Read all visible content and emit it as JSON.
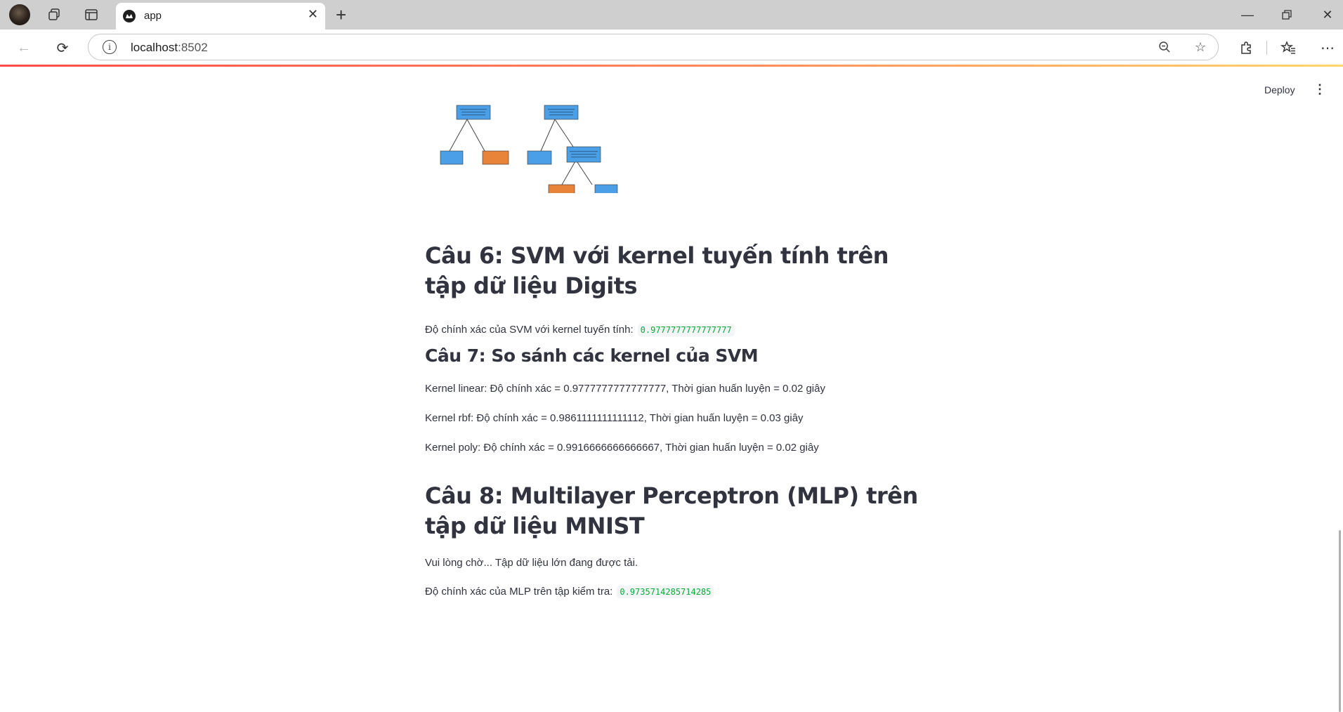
{
  "browser": {
    "tab_title": "app",
    "url_host": "localhost",
    "url_port": ":8502"
  },
  "app": {
    "deploy_label": "Deploy"
  },
  "sections": {
    "q6": {
      "title": "Câu 6: SVM với kernel tuyến tính trên tập dữ liệu Digits",
      "accuracy_label": "Độ chính xác của SVM với kernel tuyến tính:",
      "accuracy_value": "0.9777777777777777"
    },
    "q7": {
      "title": "Câu 7: So sánh các kernel của SVM",
      "lines": [
        "Kernel linear: Độ chính xác = 0.9777777777777777, Thời gian huấn luyện = 0.02 giây",
        "Kernel rbf: Độ chính xác = 0.9861111111111112, Thời gian huấn luyện = 0.03 giây",
        "Kernel poly: Độ chính xác = 0.9916666666666667, Thời gian huấn luyện = 0.02 giây"
      ]
    },
    "q8": {
      "title": "Câu 8: Multilayer Perceptron (MLP) trên tập dữ liệu MNIST",
      "loading_text": "Vui lòng chờ... Tập dữ liệu lớn đang được tải.",
      "accuracy_label": "Độ chính xác của MLP trên tập kiểm tra:",
      "accuracy_value": "0.9735714285714285"
    }
  },
  "colors": {
    "node_blue": "#4a9fe6",
    "node_orange": "#e8833a",
    "code_green": "#09ab3b",
    "loadbar_start": "#ff4b4b"
  }
}
